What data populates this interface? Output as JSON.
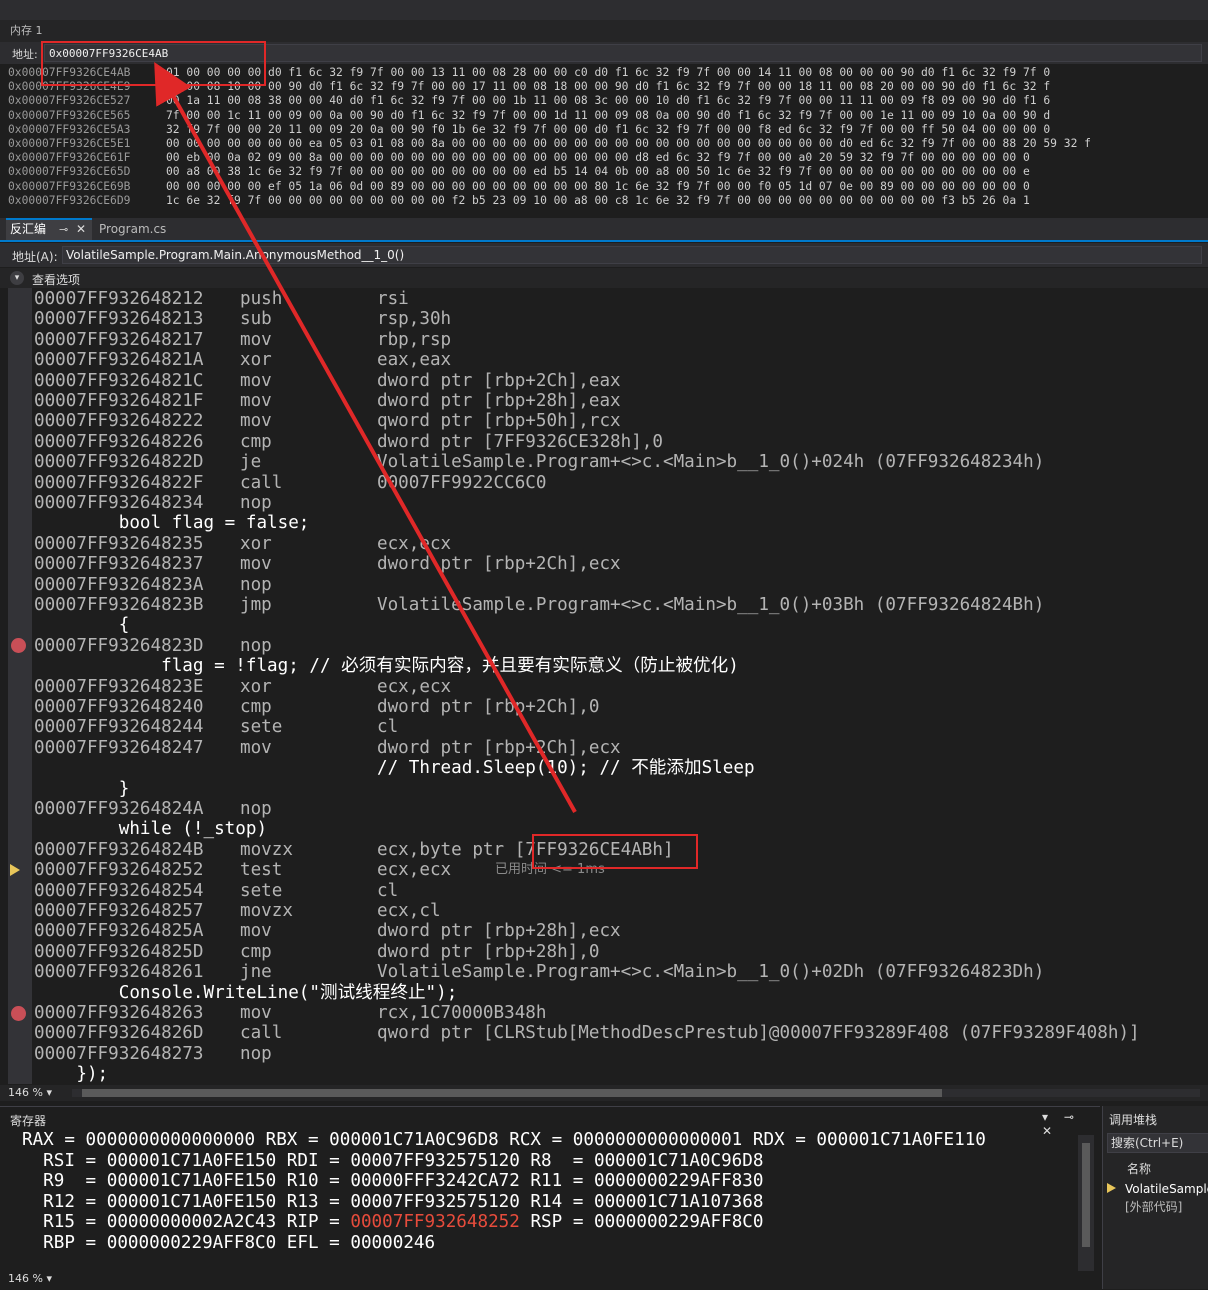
{
  "memory": {
    "title": "内存 1",
    "address_label": "地址:",
    "address_value": "0x00007FF9326CE4AB",
    "rows": [
      {
        "addr": "0x00007FF9326CE4AB",
        "bytes": "01 00 00 00 00 d0 f1 6c 32 f9 7f 00 00 13 11 00 08 28 00 00 c0 d0 f1 6c 32 f9 7f 00 00 14 11 00 08 00 00 00 90 d0 f1 6c 32 f9 7f 0"
      },
      {
        "addr": "0x00007FF9326CE4E9",
        "bytes": "11 00 08 10 00 00 90 d0 f1 6c 32 f9 7f 00 00 17 11 00 08 18 00 00 90 d0 f1 6c 32 f9 7f 00 00 18 11 00 08 20 00 00 90 d0 f1 6c 32 f"
      },
      {
        "addr": "0x00007FF9326CE527",
        "bytes": "00 1a 11 00 08 38 00 00 40 d0 f1 6c 32 f9 7f 00 00 1b 11 00 08 3c 00 00 10 d0 f1 6c 32 f9 7f 00 00 11 11 00 09 f8 09 00 90 d0 f1 6"
      },
      {
        "addr": "0x00007FF9326CE565",
        "bytes": "7f 00 00 1c 11 00 09 00 0a 00 90 d0 f1 6c 32 f9 7f 00 00 1d 11 00 09 08 0a 00 90 d0 f1 6c 32 f9 7f 00 00 1e 11 00 09 10 0a 00 90 d"
      },
      {
        "addr": "0x00007FF9326CE5A3",
        "bytes": "32 f9 7f 00 00 20 11 00 09 20 0a 00 90 f0 1b 6e 32 f9 7f 00 00 d0 f1 6c 32 f9 7f 00 00 f8 ed 6c 32 f9 7f 00 00 ff 50 04 00 00 00 0"
      },
      {
        "addr": "0x00007FF9326CE5E1",
        "bytes": "00 00 00 00 00 00 00 ea 05 03 01 08 00 8a 00 00 00 00 00 00 00 00 00 00 00 00 00 00 00 00 00 00 00 d0 ed 6c 32 f9 7f 00 00 88 20 59 32 f"
      },
      {
        "addr": "0x00007FF9326CE61F",
        "bytes": "00 eb 00 0a 02 09 00 8a 00 00 00 00 00 00 00 00 00 00 00 00 00 00 00 d8 ed 6c 32 f9 7f 00 00 a0 20 59 32 f9 7f 00 00 00 00 00 0"
      },
      {
        "addr": "0x00007FF9326CE65D",
        "bytes": "00 a8 00 38 1c 6e 32 f9 7f 00 00 00 00 00 00 00 00 00 ed b5 14 04 0b 00 a8 00 50 1c 6e 32 f9 7f 00 00 00 00 00 00 00 00 00 00 e"
      },
      {
        "addr": "0x00007FF9326CE69B",
        "bytes": "00 00 00 00 00 ef 05 1a 06 0d 00 89 00 00 00 00 00 00 00 00 00 80 1c 6e 32 f9 7f 00 00 f0 05 1d 07 0e 00 89 00 00 00 00 00 00 0"
      },
      {
        "addr": "0x00007FF9326CE6D9",
        "bytes": "1c 6e 32 f9 7f 00 00 00 00 00 00 00 00 00 f2 b5 23 09 10 00 a8 00 c8 1c 6e 32 f9 7f 00 00 00 00 00 00 00 00 00 00 f3 b5 26 0a 1"
      }
    ]
  },
  "tabs": {
    "disasm_label": "反汇编",
    "pin_glyph": "⊸",
    "close_glyph": "✕",
    "program_label": "Program.cs"
  },
  "disasm": {
    "address_label": "地址(A):",
    "address_value": "VolatileSample.Program.Main.AnonymousMethod__1_0()",
    "view_options_label": "查看选项",
    "lines": [
      {
        "a": "00007FF932648212",
        "m": "push",
        "o": "rsi"
      },
      {
        "a": "00007FF932648213",
        "m": "sub",
        "o": "rsp,30h"
      },
      {
        "a": "00007FF932648217",
        "m": "mov",
        "o": "rbp,rsp"
      },
      {
        "a": "00007FF93264821A",
        "m": "xor",
        "o": "eax,eax"
      },
      {
        "a": "00007FF93264821C",
        "m": "mov",
        "o": "dword ptr [rbp+2Ch],eax"
      },
      {
        "a": "00007FF93264821F",
        "m": "mov",
        "o": "dword ptr [rbp+28h],eax"
      },
      {
        "a": "00007FF932648222",
        "m": "mov",
        "o": "qword ptr [rbp+50h],rcx"
      },
      {
        "a": "00007FF932648226",
        "m": "cmp",
        "o": "dword ptr [7FF9326CE328h],0"
      },
      {
        "a": "00007FF93264822D",
        "m": "je",
        "o": "VolatileSample.Program+<>c.<Main>b__1_0()+024h (07FF932648234h)"
      },
      {
        "a": "00007FF93264822F",
        "m": "call",
        "o": "00007FF9922CC6C0"
      },
      {
        "a": "00007FF932648234",
        "m": "nop",
        "o": ""
      },
      {
        "src": "        bool flag = false;"
      },
      {
        "a": "00007FF932648235",
        "m": "xor",
        "o": "ecx,ecx"
      },
      {
        "a": "00007FF932648237",
        "m": "mov",
        "o": "dword ptr [rbp+2Ch],ecx"
      },
      {
        "a": "00007FF93264823A",
        "m": "nop",
        "o": ""
      },
      {
        "a": "00007FF93264823B",
        "m": "jmp",
        "o": "VolatileSample.Program+<>c.<Main>b__1_0()+03Bh (07FF93264824Bh)"
      },
      {
        "src": "        {"
      },
      {
        "a": "00007FF93264823D",
        "m": "nop",
        "o": "",
        "bp": true
      },
      {
        "src": "            flag = !flag; // 必须有实际内容，并且要有实际意义（防止被优化)"
      },
      {
        "a": "00007FF93264823E",
        "m": "xor",
        "o": "ecx,ecx"
      },
      {
        "a": "00007FF932648240",
        "m": "cmp",
        "o": "dword ptr [rbp+2Ch],0"
      },
      {
        "a": "00007FF932648244",
        "m": "sete",
        "o": "cl"
      },
      {
        "a": "00007FF932648247",
        "m": "mov",
        "o": "dword ptr [rbp+2Ch],ecx"
      },
      {
        "a": "",
        "m": "",
        "o": "// Thread.Sleep(10); // 不能添加Sleep",
        "srcop": true
      },
      {
        "src": "        }"
      },
      {
        "a": "00007FF93264824A",
        "m": "nop",
        "o": ""
      },
      {
        "src": "        while (!_stop)"
      },
      {
        "a": "00007FF93264824B",
        "m": "movzx",
        "o": "ecx,byte ptr [7FF9326CE4ABh]"
      },
      {
        "a": "00007FF932648252",
        "m": "test",
        "o": "ecx,ecx",
        "ip": true,
        "note": "已用时间 <= 1ms"
      },
      {
        "a": "00007FF932648254",
        "m": "sete",
        "o": "cl"
      },
      {
        "a": "00007FF932648257",
        "m": "movzx",
        "o": "ecx,cl"
      },
      {
        "a": "00007FF93264825A",
        "m": "mov",
        "o": "dword ptr [rbp+28h],ecx"
      },
      {
        "a": "00007FF93264825D",
        "m": "cmp",
        "o": "dword ptr [rbp+28h],0"
      },
      {
        "a": "00007FF932648261",
        "m": "jne",
        "o": "VolatileSample.Program+<>c.<Main>b__1_0()+02Dh (07FF93264823Dh)"
      },
      {
        "src": "        Console.WriteLine(\"测试线程终止\");"
      },
      {
        "a": "00007FF932648263",
        "m": "mov",
        "o": "rcx,1C70000B348h",
        "bp": true
      },
      {
        "a": "00007FF93264826D",
        "m": "call",
        "o": "qword ptr [CLRStub[MethodDescPrestub]@00007FF93289F408 (07FF93289F408h)]"
      },
      {
        "a": "00007FF932648273",
        "m": "nop",
        "o": ""
      },
      {
        "src": "    });"
      }
    ],
    "zoom": "146 %"
  },
  "registers": {
    "title": "寄存器",
    "controls": "▾ ⊸ ✕",
    "lines": [
      {
        "pre": "RAX = 0000000000000000 RBX = 000001C71A0C96D8 RCX = 0000000000000001 RDX = 000001C71A0FE110"
      },
      {
        "pre": "  RSI = 000001C71A0FE150 RDI = 00007FF932575120 R8  = 000001C71A0C96D8"
      },
      {
        "pre": "  R9  = 000001C71A0FE150 R10 = 00000FFF3242CA72 R11 = 0000000229AFF830"
      },
      {
        "pre": "  R12 = 000001C71A0FE150 R13 = 00007FF932575120 R14 = 000001C71A107368"
      },
      {
        "pre": "  R15 = 00000000002A2C43 RIP = ",
        "changed": "00007FF932648252",
        "post": " RSP = 0000000229AFF8C0"
      },
      {
        "pre": "  RBP = 0000000229AFF8C0 EFL = 00000246"
      }
    ],
    "zoom": "146 %"
  },
  "callstack": {
    "title": "调用堆栈",
    "search": "搜索(Ctrl+E)",
    "col_name": "名称",
    "row1": "VolatileSample.d",
    "row2": "[外部代码]"
  }
}
